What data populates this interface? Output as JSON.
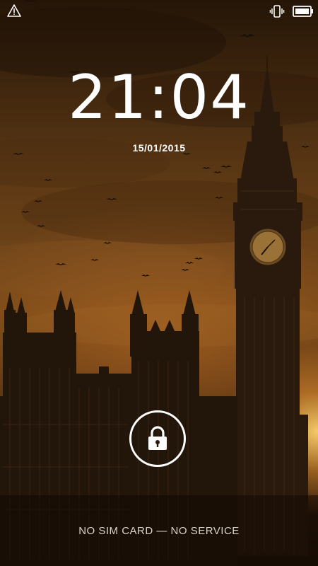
{
  "status_bar": {
    "left_icon": "alert-triangle-icon",
    "right_icons": [
      "vibrate-icon",
      "battery-full-icon"
    ],
    "icon_color": "#ffffff"
  },
  "lockscreen": {
    "time": "21:04",
    "date": "15/01/2015",
    "unlock_icon": "padlock-icon",
    "carrier_status": "NO SIM CARD — NO SERVICE"
  },
  "wallpaper": {
    "theme_colors": [
      "#241507",
      "#6e4318",
      "#f5b95a"
    ]
  }
}
